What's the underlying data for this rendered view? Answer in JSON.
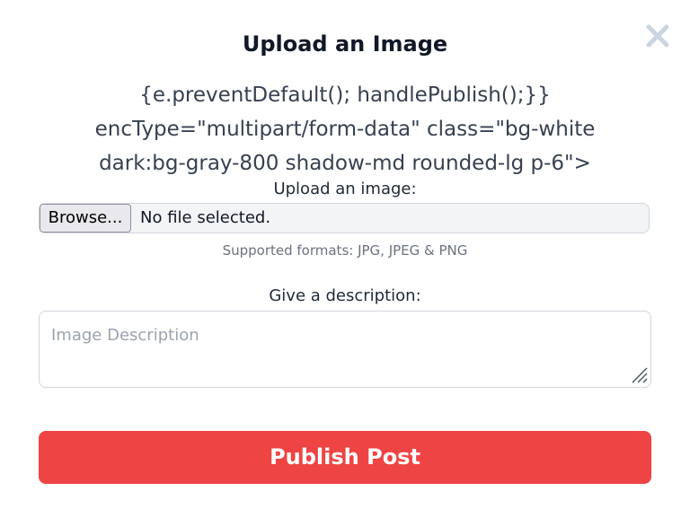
{
  "modal": {
    "title": "Upload an Image",
    "close_icon": "close-icon",
    "code_text": "{e.preventDefault(); handlePublish();}} encType=\"multipart/form-data\" class=\"bg-white dark:bg-gray-800 shadow-md rounded-lg p-6\">"
  },
  "upload": {
    "label": "Upload an image:",
    "browse_label": "Browse...",
    "file_status": "No file selected.",
    "hint": "Supported formats: JPG, JPEG & PNG"
  },
  "description": {
    "label": "Give a description:",
    "placeholder": "Image Description",
    "value": ""
  },
  "publish": {
    "label": "Publish Post"
  },
  "colors": {
    "accent": "#ef4444",
    "close_icon": "#cbd5e1"
  }
}
